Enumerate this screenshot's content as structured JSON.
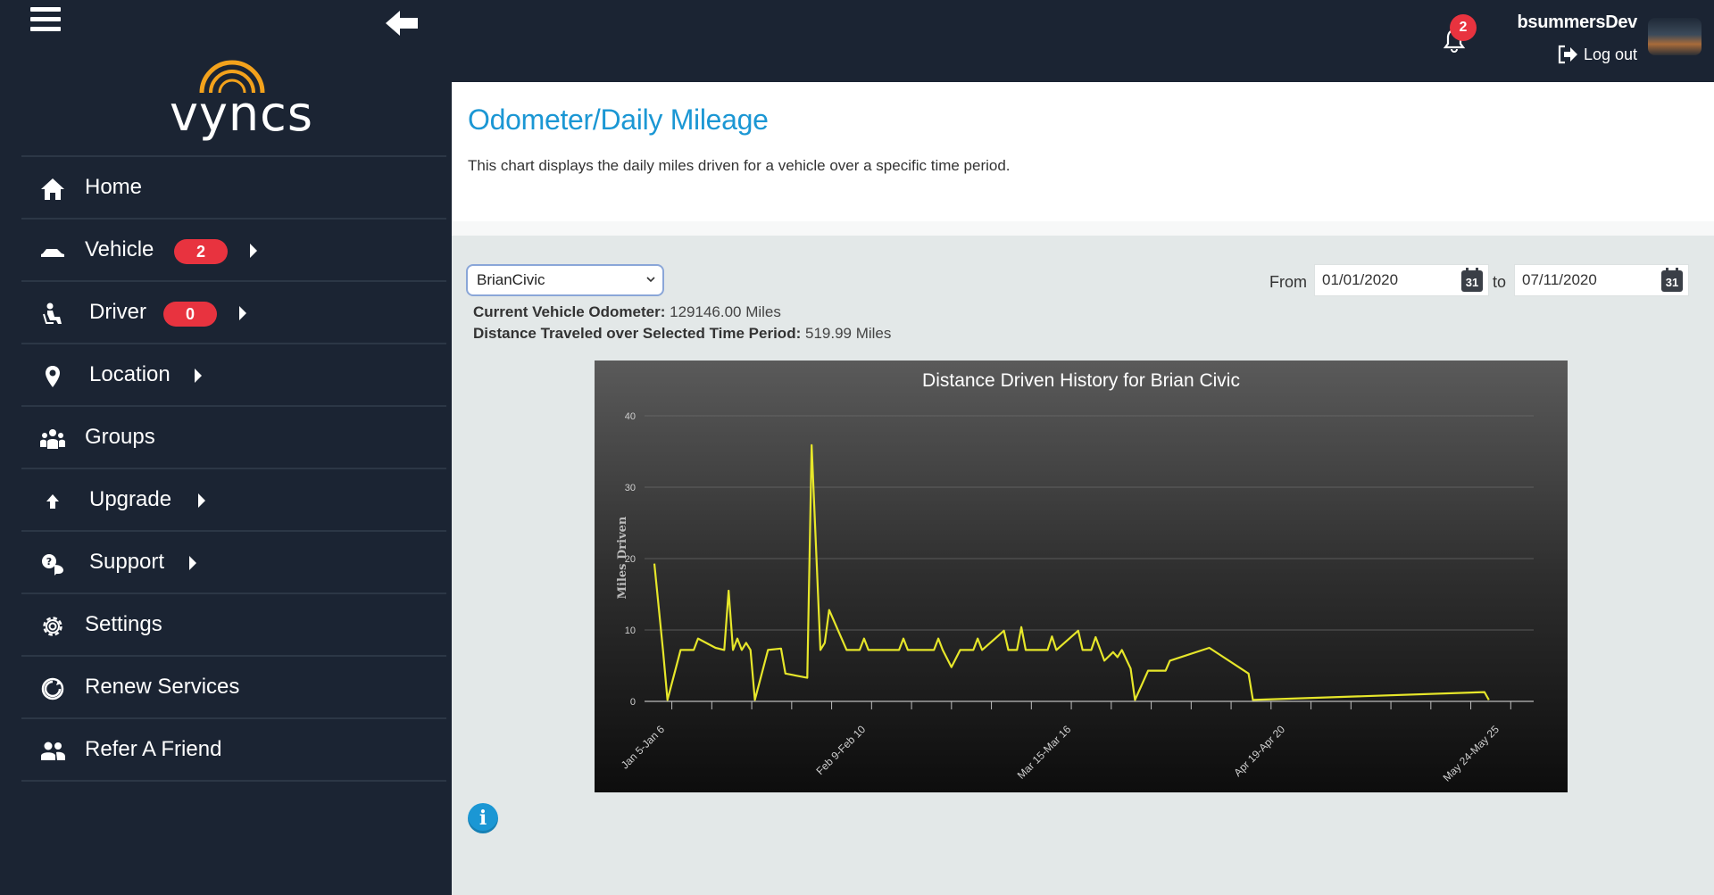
{
  "sidebar": {
    "logo_text": "vyncs",
    "items": [
      {
        "label": "Home",
        "icon": "home-icon"
      },
      {
        "label": "Vehicle",
        "icon": "car-icon",
        "badge": "2",
        "submenu": true
      },
      {
        "label": "Driver",
        "icon": "driver-icon",
        "badge": "0",
        "submenu": true
      },
      {
        "label": "Location",
        "icon": "map-pin-icon",
        "submenu": true
      },
      {
        "label": "Groups",
        "icon": "group-icon"
      },
      {
        "label": "Upgrade",
        "icon": "arrow-up-icon",
        "submenu": true
      },
      {
        "label": "Support",
        "icon": "support-icon",
        "submenu": true
      },
      {
        "label": "Settings",
        "icon": "gear-icon"
      },
      {
        "label": "Renew Services",
        "icon": "renew-icon"
      },
      {
        "label": "Refer A Friend",
        "icon": "refer-friend-icon"
      }
    ]
  },
  "topbar": {
    "notification_count": "2",
    "username": "bsummersDev",
    "logout_label": "Log out"
  },
  "page": {
    "title": "Odometer/Daily Mileage",
    "description": "This chart displays the daily miles driven for a vehicle over a specific time period."
  },
  "filters": {
    "vehicle_selected": "BrianCivic",
    "from_label": "From",
    "from_date": "01/01/2020",
    "to_label": "to",
    "to_date": "07/11/2020",
    "calendar_icon_text": "31"
  },
  "stats": {
    "odometer_label": "Current Vehicle Odometer:",
    "odometer_value": "129146.00 Miles",
    "distance_label": "Distance Traveled over Selected Time Period:",
    "distance_value": "519.99 Miles"
  },
  "colors": {
    "sidebar_bg": "#1b2433",
    "accent": "#1b97d4",
    "badge": "#e8333f",
    "chart_line": "#e6e62a"
  },
  "chart_data": {
    "type": "line",
    "title": "Distance Driven History for Brian Civic",
    "xlabel": "",
    "ylabel": "Miles Driven",
    "ylim": [
      0,
      40
    ],
    "yticks": [
      0,
      10,
      20,
      30,
      40
    ],
    "grid": true,
    "legend": "none",
    "x_tick_labels": [
      "Jan 5-Jan 6",
      "Feb 9-Feb 10",
      "Mar 15-Mar 16",
      "Apr 19-Apr 20",
      "May 24-May 25"
    ],
    "x_tick_label_index": [
      0,
      46,
      93,
      142,
      191
    ],
    "x_count": 200,
    "series": [
      {
        "points": [
          [
            0,
            19.3
          ],
          [
            2,
            7
          ],
          [
            3,
            0.2
          ],
          [
            6,
            7.2
          ],
          [
            9,
            7.2
          ],
          [
            10,
            8.8
          ],
          [
            14,
            7.5
          ],
          [
            16,
            7.2
          ],
          [
            17,
            15.5
          ],
          [
            18,
            7.2
          ],
          [
            19,
            8.8
          ],
          [
            20,
            7.2
          ],
          [
            21,
            8.2
          ],
          [
            22,
            7.2
          ],
          [
            23,
            0.2
          ],
          [
            26,
            7.2
          ],
          [
            29,
            7.4
          ],
          [
            30,
            3.9
          ],
          [
            35,
            3.3
          ],
          [
            36,
            35.9
          ],
          [
            38,
            7.2
          ],
          [
            39,
            8.2
          ],
          [
            40,
            12.8
          ],
          [
            44,
            7.2
          ],
          [
            47,
            7.2
          ],
          [
            48,
            8.8
          ],
          [
            49,
            7.2
          ],
          [
            56,
            7.2
          ],
          [
            57,
            8.8
          ],
          [
            58,
            7.2
          ],
          [
            64,
            7.2
          ],
          [
            65,
            8.8
          ],
          [
            66,
            7.2
          ],
          [
            68,
            4.8
          ],
          [
            70,
            7.2
          ],
          [
            73,
            7.2
          ],
          [
            74,
            8.8
          ],
          [
            75,
            7.2
          ],
          [
            78,
            8.8
          ],
          [
            80,
            9.9
          ],
          [
            81,
            7.2
          ],
          [
            83,
            7.2
          ],
          [
            84,
            10.4
          ],
          [
            85,
            7.2
          ],
          [
            90,
            7.2
          ],
          [
            91,
            9.1
          ],
          [
            92,
            7.2
          ],
          [
            97,
            9.9
          ],
          [
            98,
            7.2
          ],
          [
            100,
            7.2
          ],
          [
            101,
            9.0
          ],
          [
            103,
            5.7
          ],
          [
            105,
            6.9
          ],
          [
            106,
            6.2
          ],
          [
            107,
            7.2
          ],
          [
            109,
            4.6
          ],
          [
            110,
            0.2
          ],
          [
            113,
            4.3
          ],
          [
            117,
            4.3
          ],
          [
            118,
            5.7
          ],
          [
            127,
            7.5
          ],
          [
            136,
            3.9
          ],
          [
            137,
            0.2
          ],
          [
            190,
            1.3
          ],
          [
            191,
            0.2
          ]
        ]
      }
    ]
  }
}
